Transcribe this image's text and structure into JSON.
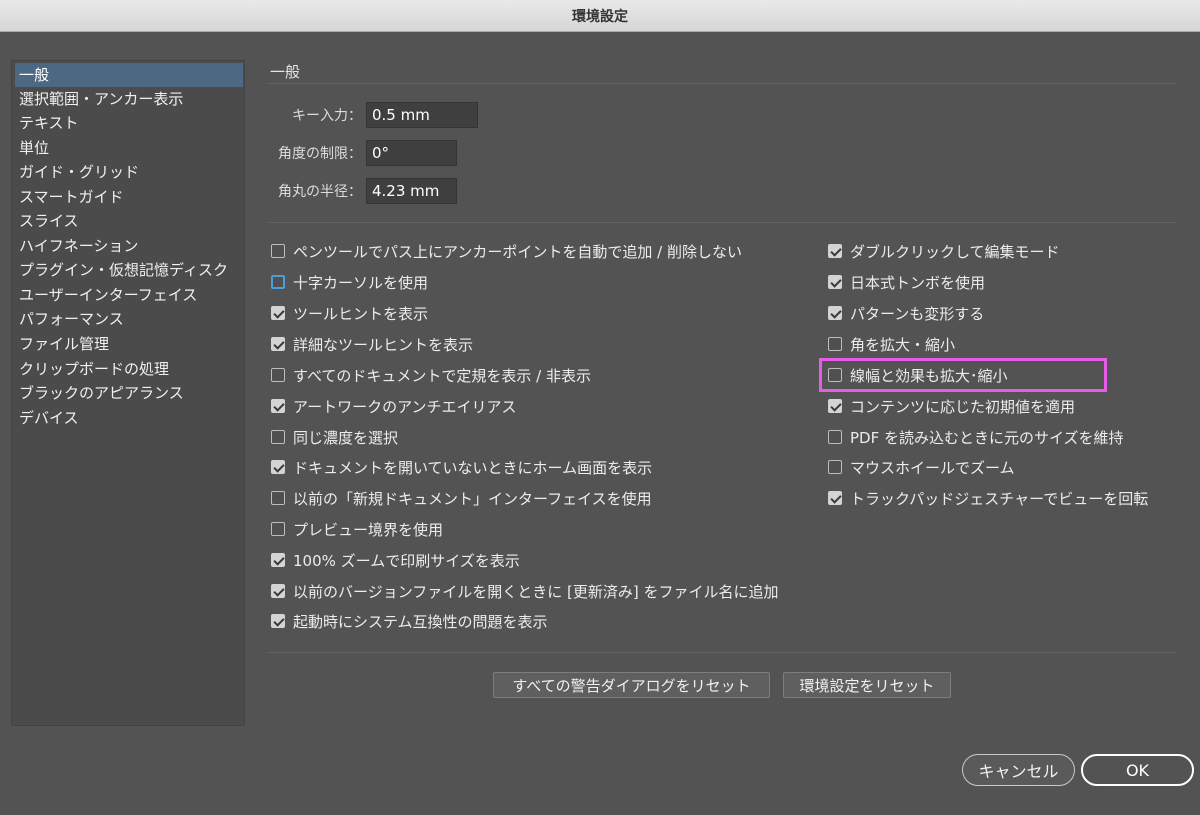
{
  "window": {
    "title": "環境設定"
  },
  "sidebar": {
    "items": [
      {
        "label": "一般",
        "selected": true
      },
      {
        "label": "選択範囲・アンカー表示"
      },
      {
        "label": "テキスト"
      },
      {
        "label": "単位"
      },
      {
        "label": "ガイド・グリッド"
      },
      {
        "label": "スマートガイド"
      },
      {
        "label": "スライス"
      },
      {
        "label": "ハイフネーション"
      },
      {
        "label": "プラグイン・仮想記憶ディスク"
      },
      {
        "label": "ユーザーインターフェイス"
      },
      {
        "label": "パフォーマンス"
      },
      {
        "label": "ファイル管理"
      },
      {
        "label": "クリップボードの処理"
      },
      {
        "label": "ブラックのアピアランス"
      },
      {
        "label": "デバイス"
      }
    ]
  },
  "main": {
    "section_title": "一般",
    "fields": {
      "key_input": {
        "label": "キー入力：",
        "value": "0.5 mm"
      },
      "angle_limit": {
        "label": "角度の制限：",
        "value": "0°"
      },
      "corner_radius": {
        "label": "角丸の半径：",
        "value": "4.23 mm"
      }
    },
    "left_options": [
      {
        "label": "ペンツールでパス上にアンカーポイントを自動で追加 / 削除しない",
        "checked": false
      },
      {
        "label": "十字カーソルを使用",
        "checked": false,
        "focused": true
      },
      {
        "label": "ツールヒントを表示",
        "checked": true
      },
      {
        "label": "詳細なツールヒントを表示",
        "checked": true
      },
      {
        "label": "すべてのドキュメントで定規を表示 / 非表示",
        "checked": false
      },
      {
        "label": "アートワークのアンチエイリアス",
        "checked": true
      },
      {
        "label": "同じ濃度を選択",
        "checked": false
      },
      {
        "label": "ドキュメントを開いていないときにホーム画面を表示",
        "checked": true
      },
      {
        "label": "以前の「新規ドキュメント」インターフェイスを使用",
        "checked": false
      },
      {
        "label": "プレビュー境界を使用",
        "checked": false
      },
      {
        "label": "100% ズームで印刷サイズを表示",
        "checked": true
      },
      {
        "label": "以前のバージョンファイルを開くときに [更新済み] をファイル名に追加",
        "checked": true
      },
      {
        "label": "起動時にシステム互換性の問題を表示",
        "checked": true
      }
    ],
    "right_options": [
      {
        "label": "ダブルクリックして編集モード",
        "checked": true
      },
      {
        "label": "日本式トンボを使用",
        "checked": true
      },
      {
        "label": "パターンも変形する",
        "checked": true
      },
      {
        "label": "角を拡大・縮小",
        "checked": false
      },
      {
        "label": "線幅と効果も拡大･縮小",
        "checked": false,
        "highlighted": true
      },
      {
        "label": "コンテンツに応じた初期値を適用",
        "checked": true
      },
      {
        "label": "PDF を読み込むときに元のサイズを維持",
        "checked": false
      },
      {
        "label": "マウスホイールでズーム",
        "checked": false
      },
      {
        "label": "トラックパッドジェスチャーでビューを回転",
        "checked": true
      }
    ],
    "buttons": {
      "reset_warnings": "すべての警告ダイアログをリセット",
      "reset_prefs": "環境設定をリセット"
    }
  },
  "footer": {
    "cancel_label": "キャンセル",
    "ok_label": "OK"
  },
  "colors": {
    "background": "#535353",
    "selection": "#4c6883",
    "highlight": "#e65be8"
  }
}
